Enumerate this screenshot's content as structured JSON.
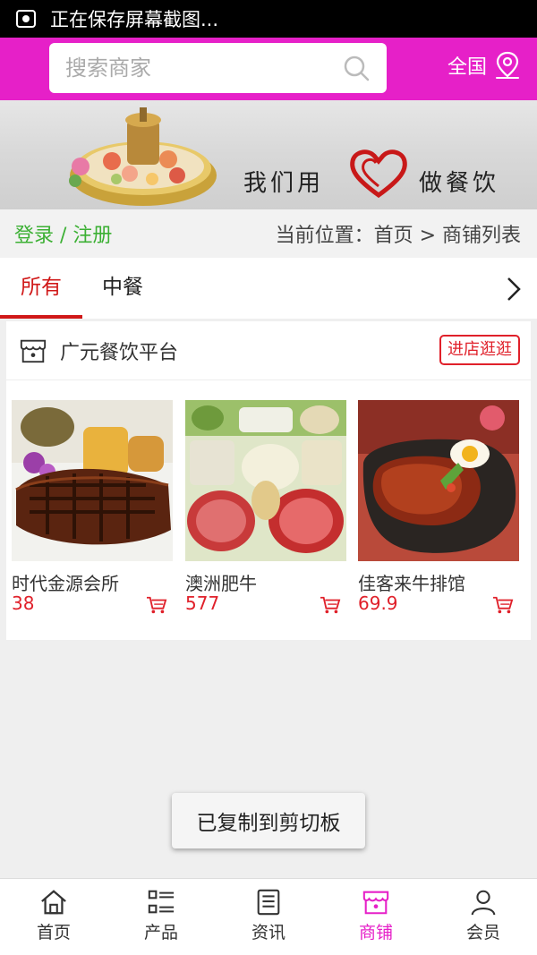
{
  "status_bar": {
    "notification": "正在保存屏幕截图..."
  },
  "header": {
    "search_placeholder": "搜索商家",
    "region_label": "全国"
  },
  "banner": {
    "slogan_left": "我们用",
    "slogan_right": "做餐饮"
  },
  "breadcrumb_bar": {
    "auth_link": "登录 / 注册",
    "location": "当前位置：首页 > 商铺列表"
  },
  "tabs": [
    {
      "label": "所有",
      "active": true
    },
    {
      "label": "中餐",
      "active": false
    }
  ],
  "shop": {
    "name": "广元餐饮平台",
    "visit_label": "进店逛逛",
    "products": [
      {
        "name": "时代金源会所",
        "price": "38"
      },
      {
        "name": "澳洲肥牛",
        "price": "577"
      },
      {
        "name": "佳客来牛排馆",
        "price": "69.9"
      }
    ]
  },
  "toast": {
    "message": "已复制到剪切板"
  },
  "bottom_nav": [
    {
      "label": "首页",
      "icon": "home-icon",
      "active": false
    },
    {
      "label": "产品",
      "icon": "list-icon",
      "active": false
    },
    {
      "label": "资讯",
      "icon": "news-icon",
      "active": false
    },
    {
      "label": "商铺",
      "icon": "store-icon",
      "active": true
    },
    {
      "label": "会员",
      "icon": "user-icon",
      "active": false
    }
  ],
  "colors": {
    "brand": "#e620c8",
    "accent_red": "#e0202a",
    "auth_green": "#3cb034"
  }
}
